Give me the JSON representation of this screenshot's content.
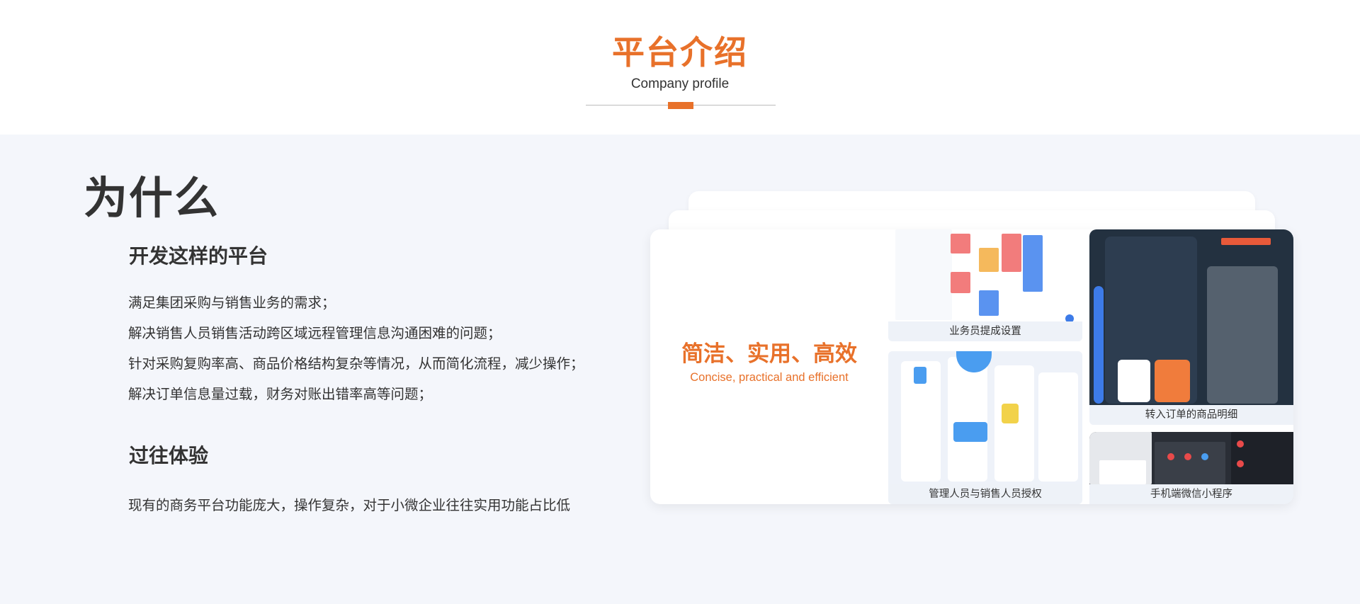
{
  "header": {
    "title": "平台介绍",
    "subtitle": "Company profile"
  },
  "content": {
    "why": "为什么",
    "dev_heading": "开发这样的平台",
    "reasons": [
      "满足集团采购与销售业务的需求；",
      "解决销售人员销售活动跨区域远程管理信息沟通困难的问题；",
      "针对采购复购率高、商品价格结构复杂等情况，从而简化流程，减少操作；",
      "解决订单信息量过载，财务对账出错率高等问题；"
    ],
    "past_heading": "过往体验",
    "past_text": "现有的商务平台功能庞大，操作复杂，对于小微企业往往实用功能占比低"
  },
  "card": {
    "slogan": "简洁、实用、高效",
    "slogan_en": "Concise, practical and efficient",
    "thumbnails": [
      {
        "caption": "业务员提成设置"
      },
      {
        "caption": "转入订单的商品明细"
      },
      {
        "caption": "管理人员与销售人员授权"
      },
      {
        "caption": "手机端微信小程序"
      }
    ]
  },
  "colors": {
    "accent": "#e8712a",
    "background": "#f4f6fb",
    "text": "#333333"
  }
}
